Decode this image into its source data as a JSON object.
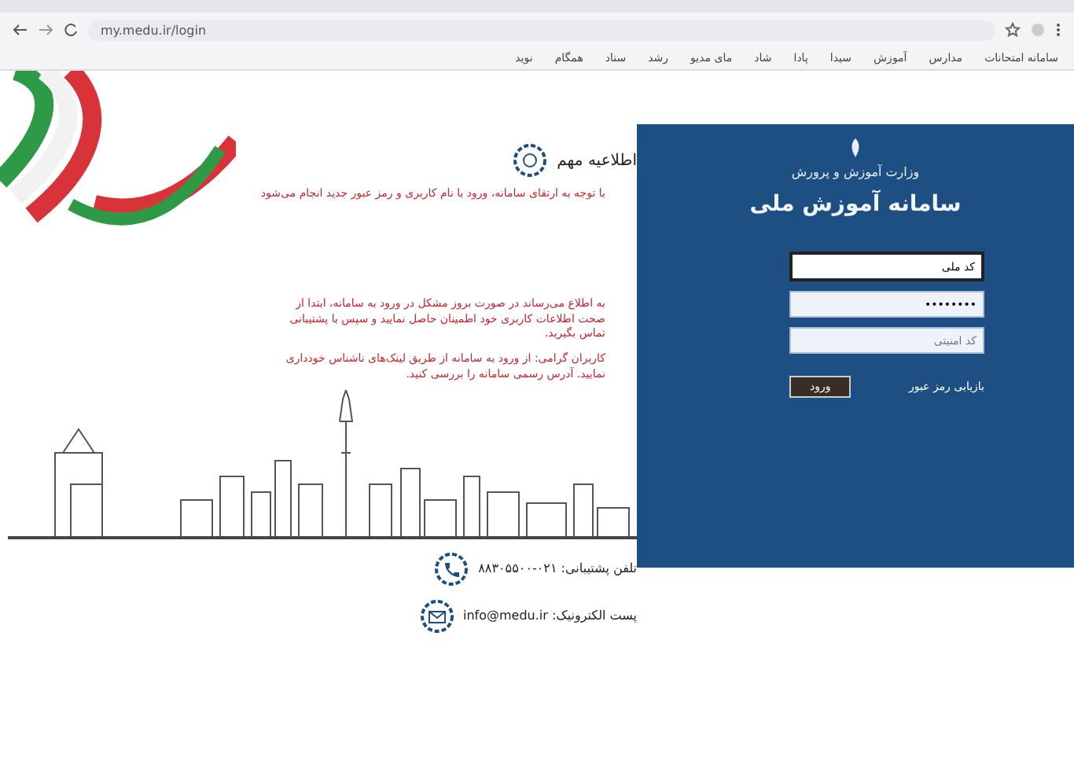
{
  "browser": {
    "url": "my.medu.ir/login",
    "bookmarks": [
      {
        "label": "سامانه امتحانات"
      },
      {
        "label": "مدارس"
      },
      {
        "label": "آموزش"
      },
      {
        "label": "سیدا"
      },
      {
        "label": "پادا"
      },
      {
        "label": "شاد"
      },
      {
        "label": "مای مدیو"
      },
      {
        "label": "رشد"
      },
      {
        "label": "سناد"
      },
      {
        "label": "همگام"
      },
      {
        "label": "نوید"
      }
    ]
  },
  "notice": {
    "title": "اطلاعیه مهم",
    "lines": [
      {
        "text": "با توجه به ارتقای سامانه، ورود با نام کاربری و رمز عبور جدید انجام می‌شود"
      },
      {
        "text": "به اطلاع می‌رساند در صورت بروز مشکل در ورود به سامانه، ابتدا از صحت اطلاعات کاربری خود اطمینان حاصل نمایید و سپس با پشتیبانی تماس بگیرید."
      },
      {
        "text": "کاربران گرامی: از ورود به سامانه از طریق لینک‌های ناشناس خودداری نمایید. آدرس رسمی سامانه را بررسی کنید."
      }
    ]
  },
  "contacts": [
    {
      "kind": "phone",
      "text": "تلفن پشتیبانی: ۰۲۱-۸۸۳۰۵۵۰۰"
    },
    {
      "kind": "email",
      "text": "پست الکترونیک: info@medu.ir"
    }
  ],
  "login": {
    "ministry": "وزارت آموزش و پرورش",
    "title": "سامانه آموزش ملی",
    "fields": [
      {
        "kind": "text",
        "value": "کد ملی"
      },
      {
        "kind": "password",
        "value": "••••••••"
      },
      {
        "kind": "captcha",
        "placeholder": "کد امنیتی"
      }
    ],
    "button": "ورود",
    "forgot": "بازیابی رمز عبور"
  }
}
